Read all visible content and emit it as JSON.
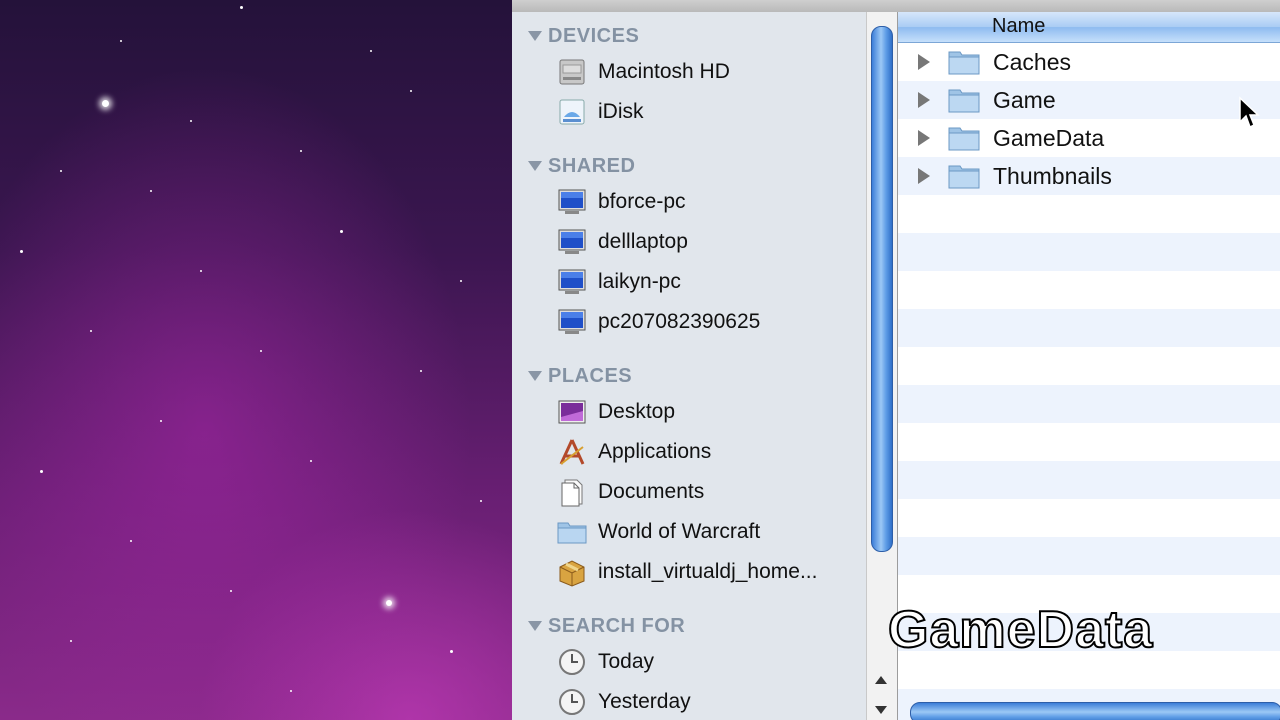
{
  "sidebar": {
    "sections": [
      {
        "header": "DEVICES",
        "items": [
          {
            "label": "Macintosh HD",
            "icon": "hard-drive-icon"
          },
          {
            "label": "iDisk",
            "icon": "idisk-icon"
          }
        ]
      },
      {
        "header": "SHARED",
        "items": [
          {
            "label": "bforce-pc",
            "icon": "pc-monitor-icon"
          },
          {
            "label": "delllaptop",
            "icon": "pc-monitor-icon"
          },
          {
            "label": "laikyn-pc",
            "icon": "pc-monitor-icon"
          },
          {
            "label": "pc207082390625",
            "icon": "pc-monitor-icon"
          }
        ]
      },
      {
        "header": "PLACES",
        "items": [
          {
            "label": "Desktop",
            "icon": "desktop-icon"
          },
          {
            "label": "Applications",
            "icon": "applications-icon"
          },
          {
            "label": "Documents",
            "icon": "documents-icon"
          },
          {
            "label": "World of Warcraft",
            "icon": "folder-icon"
          },
          {
            "label": "install_virtualdj_home...",
            "icon": "package-icon"
          }
        ]
      },
      {
        "header": "SEARCH FOR",
        "items": [
          {
            "label": "Today",
            "icon": "clock-icon"
          },
          {
            "label": "Yesterday",
            "icon": "clock-icon"
          }
        ]
      }
    ]
  },
  "filelist": {
    "column_header": "Name",
    "rows": [
      {
        "name": "Caches"
      },
      {
        "name": "Game"
      },
      {
        "name": "GameData"
      },
      {
        "name": "Thumbnails"
      }
    ]
  },
  "caption": "GameData",
  "colors": {
    "sidebar_bg": "#e1e6ec",
    "section_header": "#8492a3",
    "selection_blue": "#5f9de6",
    "row_stripe": "#edf3fd"
  }
}
